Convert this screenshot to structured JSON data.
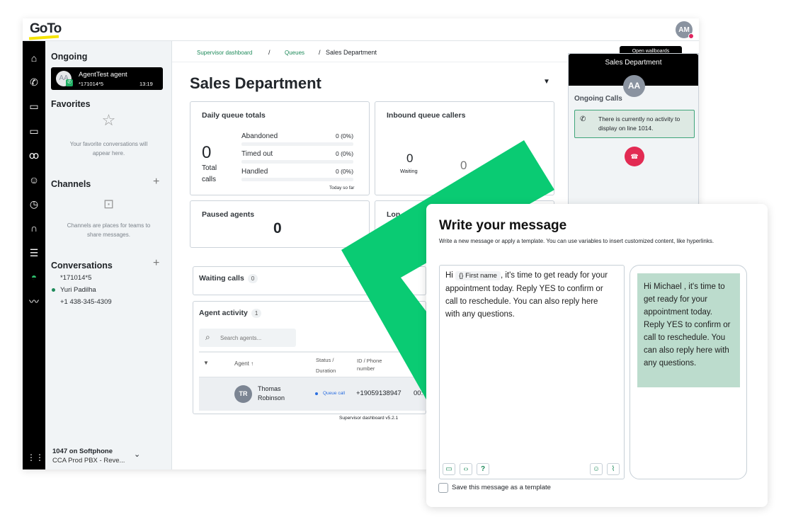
{
  "app": {
    "logo": "GoTo",
    "user_initials": "AM"
  },
  "rail": {
    "icons": [
      "home-icon",
      "phone-icon",
      "chat-icon",
      "video-icon",
      "voicemail-icon",
      "contacts-icon",
      "history-icon",
      "headset-icon",
      "settings-sliders-icon",
      "dashboard-gauge-icon",
      "analytics-icon",
      "apps-grid-icon"
    ]
  },
  "sidebar": {
    "ongoing_title": "Ongoing",
    "ongoing_call": {
      "initials": "AA",
      "name": "AgentTest agent",
      "number": "*171014*5",
      "duration": "13:19"
    },
    "favorites_title": "Favorites",
    "favorites_empty": "Your favorite conversations will appear here.",
    "channels_title": "Channels",
    "channels_empty": "Channels are places for teams to share messages.",
    "conversations_title": "Conversations",
    "conversations": [
      {
        "label": "*171014*5",
        "online": false
      },
      {
        "label": "Yuri Padilha",
        "online": true
      },
      {
        "label": "+1 438-345-4309",
        "online": false
      }
    ],
    "line_title": "1047 on Softphone",
    "line_sub": "CCA Prod PBX - Reve..."
  },
  "breadcrumb": [
    "Supervisor dashboard",
    "Queues",
    "Sales Department"
  ],
  "page_title": "Sales Department",
  "daily": {
    "title": "Daily queue totals",
    "total": "0",
    "total_label": "Total calls",
    "rows": [
      {
        "label": "Abandoned",
        "value": "0 (0%)",
        "fraction": 0
      },
      {
        "label": "Timed out",
        "value": "0 (0%)",
        "fraction": 0
      },
      {
        "label": "Handled",
        "value": "0 (0%)",
        "fraction": 0
      }
    ],
    "footer": "Today so far"
  },
  "inbound": {
    "title": "Inbound queue callers",
    "waiting": "0",
    "waiting_label": "Waiting",
    "other": "0"
  },
  "paused": {
    "title": "Paused agents",
    "value": "0"
  },
  "longest": {
    "title": "Lon"
  },
  "waiting_calls": {
    "title": "Waiting calls",
    "count": "0"
  },
  "agent_activity": {
    "title": "Agent activity",
    "count": "1",
    "search_placeholder": "Search agents...",
    "columns": [
      "Agent",
      "Status / Duration",
      "ID / Phone number"
    ],
    "rows": [
      {
        "initials": "TR",
        "name": "Thomas Robinson",
        "status": "Queue call",
        "phone": "+19059138947",
        "duration": "00:"
      }
    ]
  },
  "version": "Supervisor dashboard v5.2.1",
  "right_panel": {
    "tab": "Open wallboards",
    "title": "Sales Department",
    "initials": "AA",
    "section": "Ongoing Calls",
    "notice": "There is currently no activity to display on line 1014."
  },
  "message": {
    "title": "Write your message",
    "subtitle": "Write a new message or apply a template. You can use variables to insert customized content, like hyperlinks.",
    "pre": "Hi",
    "variable": "{} First name",
    "post": ", it's time to get ready for your appointment today. Reply YES to confirm or call to reschedule. You can also reply here with any questions.",
    "preview": "Hi Michael  , it's time to get ready for your appointment today. Reply YES to confirm or call to reschedule. You can also reply here with any questions.",
    "save_template": "Save this message as a template"
  },
  "colors": {
    "accent_green": "#0acb73",
    "link_green": "#1e8a5a",
    "hangup_red": "#e22b53",
    "preview_bg": "#bcdccd",
    "status_blue": "#2a6ee0"
  }
}
